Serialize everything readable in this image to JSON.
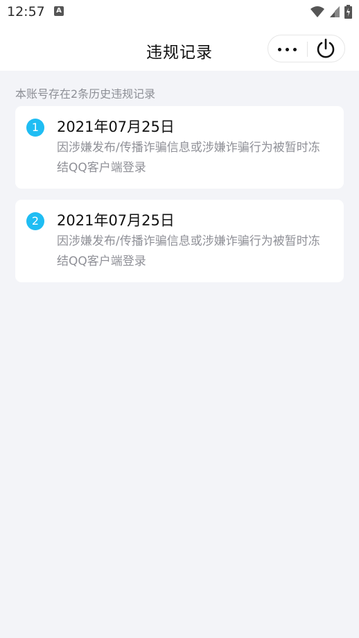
{
  "status_bar": {
    "time": "12:57",
    "notification_icon": "a-icon"
  },
  "header": {
    "title": "违规记录"
  },
  "summary": "本账号存在2条历史违规记录",
  "records": [
    {
      "index": "1",
      "date": "2021年07月25日",
      "description": "因涉嫌发布/传播诈骗信息或涉嫌诈骗行为被暂时冻结QQ客户端登录"
    },
    {
      "index": "2",
      "date": "2021年07月25日",
      "description": "因涉嫌发布/传播诈骗信息或涉嫌诈骗行为被暂时冻结QQ客户端登录"
    }
  ],
  "colors": {
    "badge": "#1fbdf3",
    "background": "#f3f4f8",
    "summary_text": "#8d8f96"
  }
}
